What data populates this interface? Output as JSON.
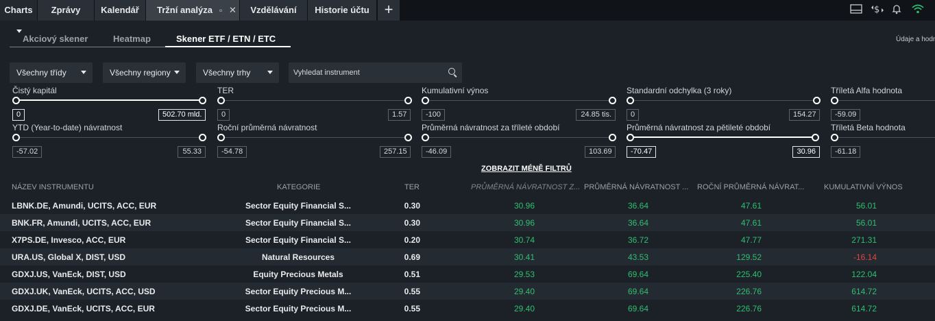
{
  "top_tabs": {
    "charts": "Charts",
    "zpravy": "Zprávy",
    "kalendar": "Kalendář",
    "trzni_analyza": "Tržní analýza",
    "vzdelavani": "Vzdělávání",
    "historie": "Historie účtu",
    "plus": "+"
  },
  "sub_tabs": {
    "akciovy": "Akciový skener",
    "heatmap": "Heatmap",
    "etf": "Skener ETF / ETN / ETC"
  },
  "udaje": "Údaje a hodn",
  "dropdowns": {
    "tridy": "Všechny třídy",
    "regiony": "Všechny regiony",
    "trhy": "Všechny trhy"
  },
  "search": {
    "placeholder": "Vyhledat instrument"
  },
  "filters": {
    "cisty_kapital": {
      "label": "Čistý kapitál",
      "min": "0",
      "max": "502.70 mld."
    },
    "ter": {
      "label": "TER",
      "min": "0",
      "max": "1.57"
    },
    "kumulativni": {
      "label": "Kumulativní výnos",
      "min": "-100",
      "max": "24.85 tis."
    },
    "std_odchylka": {
      "label": "Standardní odchylka (3 roky)",
      "min": "0",
      "max": "154.27"
    },
    "alfa": {
      "label": "Tříletá Alfa hodnota",
      "min": "-59.09"
    },
    "ytd": {
      "label": "YTD (Year-to-date) návratnost",
      "min": "-57.02",
      "max": "55.33"
    },
    "rocni": {
      "label": "Roční průměrná návratnost",
      "min": "-54.78",
      "max": "257.15"
    },
    "trilete": {
      "label": "Průměrná návratnost za tříleté období",
      "min": "-46.09",
      "max": "103.69"
    },
    "petilete": {
      "label": "Průměrná návratnost za pětileté období",
      "min": "-70.47",
      "max": "30.96"
    },
    "beta": {
      "label": "Tříletá Beta hodnota",
      "min": "-61.18"
    }
  },
  "toggle_filters": "ZOBRAZIT MÉNĚ FILTRŮ",
  "table": {
    "headers": {
      "name": "NÁZEV INSTRUMENTU",
      "category": "KATEGORIE",
      "ter": "TER",
      "avg5": "PRŮMĚRNÁ NÁVRATNOST Z...",
      "avg3": "PRŮMĚRNÁ NÁVRATNOST ...",
      "annual": "ROČNÍ PRŮMĚRNÁ NÁVRAT...",
      "cumul": "KUMULATIVNÍ VÝNOS"
    },
    "rows": [
      {
        "name": "LBNK.DE, Amundi, UCITS, ACC, EUR",
        "category": "Sector Equity Financial S...",
        "ter": "0.30",
        "avg5": "30.96",
        "avg3": "36.64",
        "annual": "47.61",
        "cumul": "56.01"
      },
      {
        "name": "BNK.FR, Amundi, UCITS, ACC, EUR",
        "category": "Sector Equity Financial S...",
        "ter": "0.30",
        "avg5": "30.96",
        "avg3": "36.64",
        "annual": "47.61",
        "cumul": "56.01"
      },
      {
        "name": "X7PS.DE, Invesco, ACC, EUR",
        "category": "Sector Equity Financial S...",
        "ter": "0.20",
        "avg5": "30.74",
        "avg3": "36.72",
        "annual": "47.77",
        "cumul": "271.31"
      },
      {
        "name": "URA.US, Global X, DIST, USD",
        "category": "Natural Resources",
        "ter": "0.69",
        "avg5": "30.41",
        "avg3": "43.53",
        "annual": "129.52",
        "cumul": "-16.14"
      },
      {
        "name": "GDXJ.US, VanEck, DIST, USD",
        "category": "Equity Precious Metals",
        "ter": "0.51",
        "avg5": "29.53",
        "avg3": "69.64",
        "annual": "225.40",
        "cumul": "122.04"
      },
      {
        "name": "GDXJ.UK, VanEck, UCITS, ACC, USD",
        "category": "Sector Equity Precious M...",
        "ter": "0.55",
        "avg5": "29.40",
        "avg3": "69.64",
        "annual": "226.76",
        "cumul": "614.72"
      },
      {
        "name": "GDXJ.DE, VanEck, UCITS, ACC, EUR",
        "category": "Sector Equity Precious M...",
        "ter": "0.55",
        "avg5": "29.40",
        "avg3": "69.64",
        "annual": "226.76",
        "cumul": "614.72"
      }
    ]
  },
  "colors": {
    "positive": "#2fbf71",
    "negative": "#e0463f",
    "background": "#1c2127",
    "alt_row": "#242a31"
  }
}
